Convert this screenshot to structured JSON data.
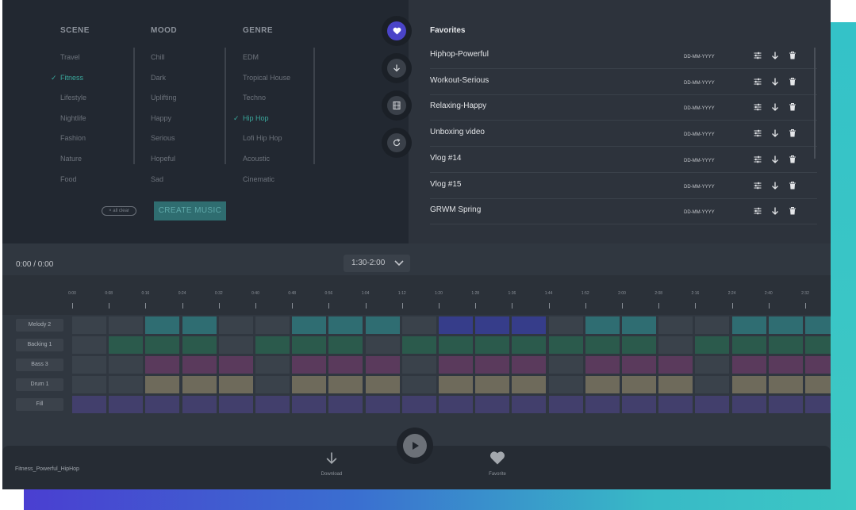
{
  "selector": {
    "columns": [
      {
        "key": "scene",
        "title": "SCENE",
        "items": [
          "Travel",
          "Fitness",
          "Lifestyle",
          "Nightlife",
          "Fashion",
          "Nature",
          "Food"
        ],
        "selected": 1
      },
      {
        "key": "mood",
        "title": "MOOD",
        "items": [
          "Chill",
          "Dark",
          "Uplifting",
          "Happy",
          "Serious",
          "Hopeful",
          "Sad"
        ],
        "selected": -1
      },
      {
        "key": "genre",
        "title": "GENRE",
        "items": [
          "EDM",
          "Tropical House",
          "Techno",
          "Hip Hop",
          "Lofi Hip Hop",
          "Acoustic",
          "Cinematic"
        ],
        "selected": 3
      }
    ],
    "clear_label": "× all clear",
    "create_label": "CREATE MUSIC",
    "check_glyph": "✓"
  },
  "side_tabs": [
    {
      "icon": "heart-icon",
      "active": true
    },
    {
      "icon": "download-icon",
      "active": false
    },
    {
      "icon": "film-icon",
      "active": false
    },
    {
      "icon": "refresh-icon",
      "active": false
    }
  ],
  "favorites": {
    "title": "Favorites",
    "items": [
      {
        "name": "Hiphop-Powerful",
        "date": "DD-MM-YYYY"
      },
      {
        "name": "Workout-Serious",
        "date": "DD-MM-YYYY"
      },
      {
        "name": "Relaxing-Happy",
        "date": "DD-MM-YYYY"
      },
      {
        "name": "Unboxing video",
        "date": "DD-MM-YYYY"
      },
      {
        "name": "Vlog #14",
        "date": "DD-MM-YYYY"
      },
      {
        "name": "Vlog #15",
        "date": "DD-MM-YYYY"
      },
      {
        "name": "GRWM Spring",
        "date": "DD-MM-YYYY"
      }
    ],
    "row_icons": [
      "sliders-icon",
      "download-icon",
      "trash-icon"
    ]
  },
  "timeline": {
    "time": "0:00 / 0:00",
    "range": "1:30-2:00",
    "ticks": [
      "0:00",
      "0:08",
      "0:16",
      "0:24",
      "0:32",
      "0:40",
      "0:48",
      "0:56",
      "1:04",
      "1:12",
      "1:20",
      "1:28",
      "1:36",
      "1:44",
      "1:52",
      "2:00",
      "2:08",
      "2:16",
      "2:24",
      "2:40",
      "2:32"
    ],
    "tracks": [
      {
        "label": "Melody 2",
        "pattern": [
          0,
          0,
          1,
          1,
          0,
          0,
          1,
          1,
          1,
          0,
          2,
          2,
          2,
          0,
          1,
          1,
          0,
          0,
          1,
          1,
          1
        ]
      },
      {
        "label": "Backing 1",
        "pattern": [
          0,
          1,
          1,
          1,
          0,
          1,
          1,
          1,
          0,
          1,
          1,
          1,
          1,
          1,
          1,
          1,
          0,
          1,
          1,
          1,
          1
        ]
      },
      {
        "label": "Bass 3",
        "pattern": [
          0,
          0,
          1,
          1,
          1,
          0,
          1,
          1,
          1,
          0,
          1,
          1,
          1,
          0,
          1,
          1,
          1,
          0,
          1,
          1,
          1
        ]
      },
      {
        "label": "Drum 1",
        "pattern": [
          0,
          0,
          1,
          1,
          1,
          0,
          1,
          1,
          1,
          0,
          1,
          1,
          1,
          0,
          1,
          1,
          1,
          0,
          1,
          1,
          1
        ]
      },
      {
        "label": "Fill",
        "pattern": [
          1,
          1,
          1,
          1,
          1,
          1,
          1,
          1,
          1,
          1,
          1,
          1,
          1,
          1,
          1,
          1,
          1,
          1,
          1,
          1,
          1
        ]
      }
    ],
    "colors": {
      "Melody 2": [
        "#3a424b",
        "#2f6d72",
        "#363d8a"
      ],
      "Backing 1": [
        "#3a424b",
        "#2b5a4c"
      ],
      "Bass 3": [
        "#3a424b",
        "#5a3a5c"
      ],
      "Drum 1": [
        "#3a424b",
        "#6e6a5b"
      ],
      "Fill": [
        "#3a424b",
        "#423f6c"
      ]
    }
  },
  "bottom_bar": {
    "track_name": "Fitness_Powerful_HipHop",
    "download_label": "Download",
    "favorite_label": "Favorite"
  }
}
